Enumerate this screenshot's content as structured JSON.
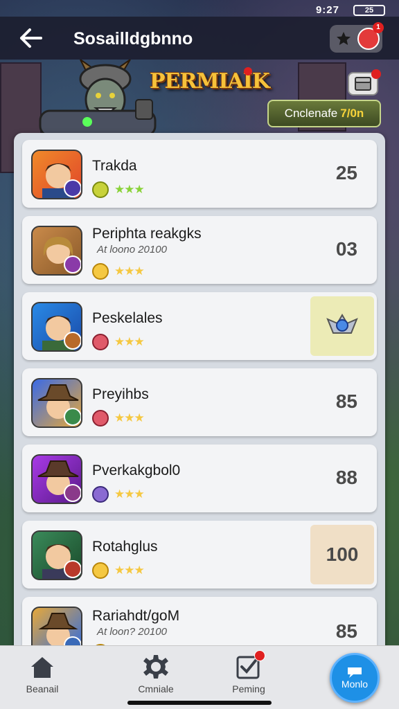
{
  "status_bar": {
    "time": "9:27",
    "battery": "25"
  },
  "header": {
    "title": "Sosailldgbnno",
    "action_badge": "1"
  },
  "banner": {
    "logo": "PERMIAIK",
    "event_label": "Cnclenafe",
    "event_value": "7/0n"
  },
  "rows": [
    {
      "name": "Trakda",
      "sub": "",
      "score": "25",
      "score_box": false
    },
    {
      "name": "Periphta reakgks",
      "sub": "At loono 20100",
      "score": "03",
      "score_box": false
    },
    {
      "name": "Peskelales",
      "sub": "",
      "score": "",
      "score_box": true,
      "score_box_color": "#ecebb6"
    },
    {
      "name": "Preyihbs",
      "sub": "",
      "score": "85",
      "score_box": false
    },
    {
      "name": "Pverkakgbol0",
      "sub": "",
      "score": "88",
      "score_box": false
    },
    {
      "name": "Rotahglus",
      "sub": "",
      "score": "100",
      "score_box": true,
      "score_box_color": "#f0dfc6"
    },
    {
      "name": "Rariahdt/goM",
      "sub": "At loon? 20100",
      "score": "85",
      "score_box": false
    }
  ],
  "nav": {
    "items": [
      {
        "label": "Beanail",
        "icon": "home-icon"
      },
      {
        "label": "Cmniale",
        "icon": "gear-icon"
      },
      {
        "label": "Peming",
        "icon": "checklist-icon"
      }
    ],
    "fab_label": "Monlo"
  },
  "colors": {
    "accent": "#1e90e6",
    "badge": "#e02020",
    "star": "#f5c842"
  }
}
